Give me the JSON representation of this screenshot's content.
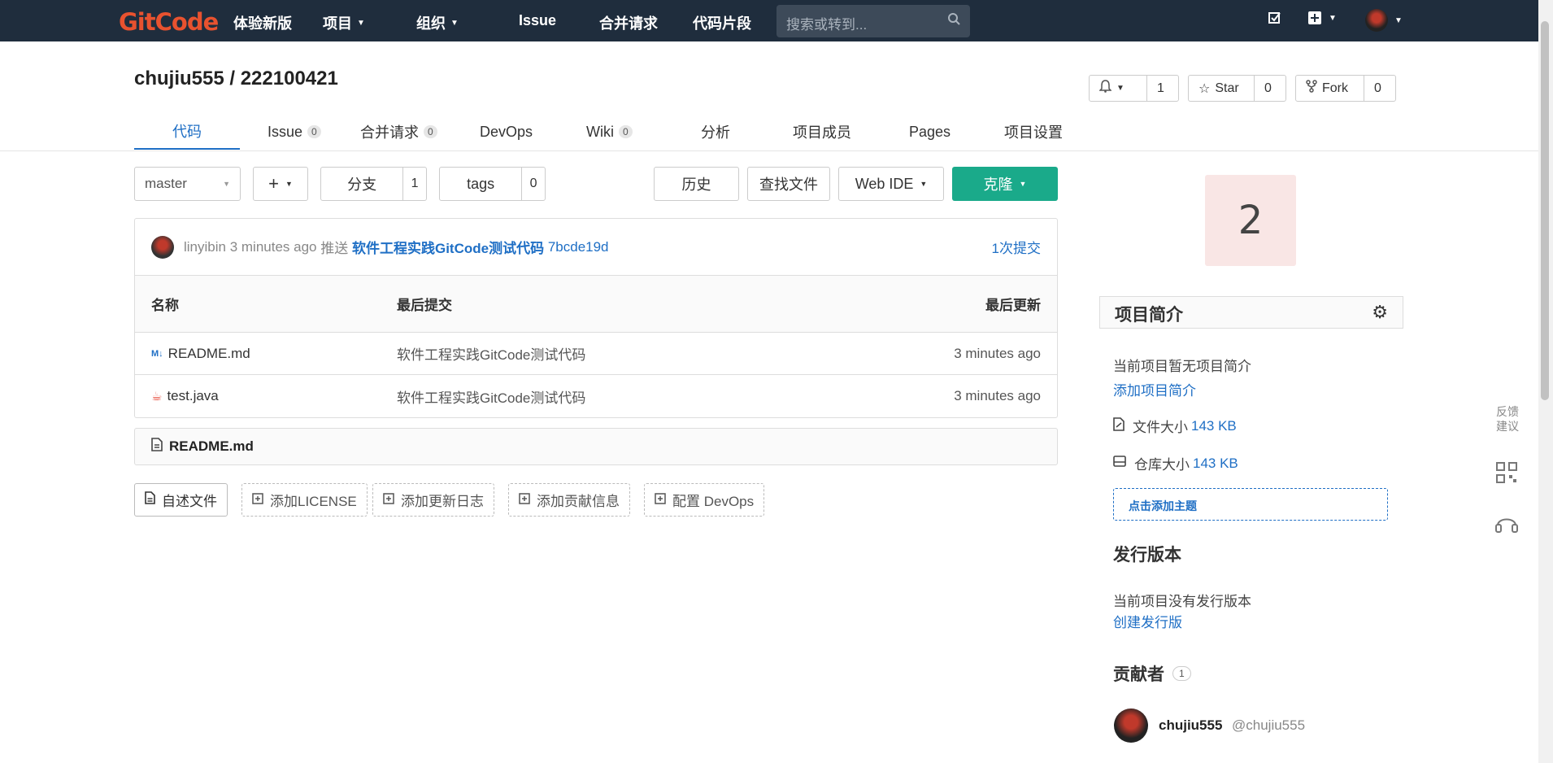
{
  "nav": {
    "logo": "GitCode",
    "items": [
      "体验新版",
      "项目",
      "组织",
      "Issue",
      "合并请求",
      "代码片段"
    ],
    "search_placeholder": "搜索或转到..."
  },
  "project": {
    "title": "chujiu555 / 222100421",
    "watch_count": "1",
    "star_label": "Star",
    "star_count": "0",
    "fork_label": "Fork",
    "fork_count": "0"
  },
  "tabs": [
    {
      "label": "代码"
    },
    {
      "label": "Issue",
      "badge": "0"
    },
    {
      "label": "合并请求",
      "badge": "0"
    },
    {
      "label": "DevOps"
    },
    {
      "label": "Wiki",
      "badge": "0"
    },
    {
      "label": "分析"
    },
    {
      "label": "项目成员"
    },
    {
      "label": "Pages"
    },
    {
      "label": "项目设置"
    }
  ],
  "toolbar": {
    "branch": "master",
    "branches_label": "分支",
    "branches_count": "1",
    "tags_label": "tags",
    "tags_count": "0",
    "history": "历史",
    "find_file": "查找文件",
    "web_ide": "Web IDE",
    "clone": "克隆"
  },
  "commit": {
    "author": "linyibin",
    "time": "3 minutes ago",
    "action": "推送",
    "message": "软件工程实践GitCode测试代码",
    "sha": "7bcde19d",
    "count": "1次提交"
  },
  "table": {
    "headers": [
      "名称",
      "最后提交",
      "最后更新"
    ],
    "rows": [
      {
        "name": "README.md",
        "commit": "软件工程实践GitCode测试代码",
        "updated": "3 minutes ago"
      },
      {
        "name": "test.java",
        "commit": "软件工程实践GitCode测试代码",
        "updated": "3 minutes ago"
      }
    ]
  },
  "readme_title": "README.md",
  "add_buttons": [
    "自述文件",
    "添加LICENSE",
    "添加更新日志",
    "添加贡献信息",
    "配置 DevOps"
  ],
  "sidebar": {
    "big_number": "2",
    "intro_title": "项目简介",
    "no_intro": "当前项目暂无项目简介",
    "add_intro": "添加项目简介",
    "file_size_label": "文件大小",
    "file_size": "143 KB",
    "repo_size_label": "仓库大小",
    "repo_size": "143 KB",
    "add_topic": "点击添加主题",
    "release_title": "发行版本",
    "no_release": "当前项目没有发行版本",
    "create_release": "创建发行版",
    "contrib_title": "贡献者",
    "contrib_count": "1",
    "contrib_name": "chujiu555",
    "contrib_handle": "@chujiu555"
  },
  "float": {
    "feedback": "反馈建议"
  }
}
